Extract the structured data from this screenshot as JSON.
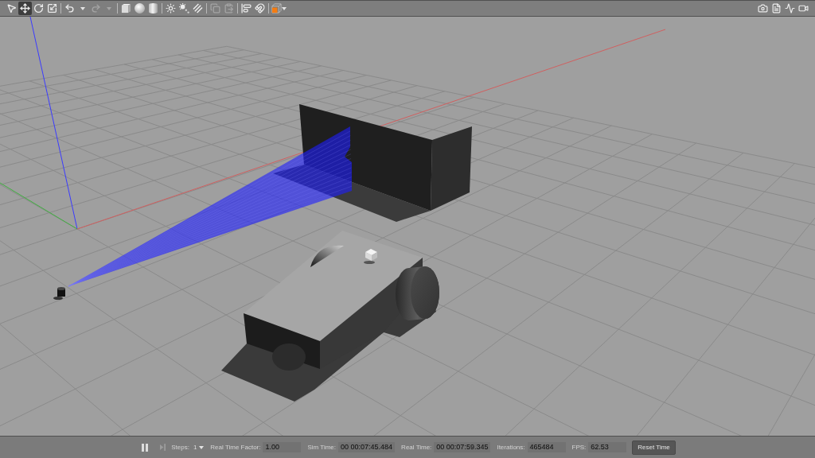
{
  "toolbar": {
    "transform_modes": [
      {
        "selected": false
      },
      {
        "selected": true
      },
      {
        "selected": false
      },
      {
        "selected": false
      }
    ],
    "history": [
      {
        "disabled": false
      },
      {
        "disabled": true
      }
    ],
    "clipboard": [
      {
        "disabled": true
      },
      {
        "disabled": true
      }
    ]
  },
  "status_bar": {
    "play_pause": {
      "running": true
    },
    "step_button": {
      "disabled": true
    },
    "steps": {
      "label": "Steps:",
      "value": "1"
    },
    "readouts": [
      {
        "label": "Real Time Factor:",
        "value": "1.00"
      },
      {
        "label": "Sim Time:",
        "value": "00 00:07:45.484"
      },
      {
        "label": "Real Time:",
        "value": "00 00:07:59.345"
      },
      {
        "label": "Iterations:",
        "value": "465484"
      },
      {
        "label": "FPS:",
        "value": "62.53"
      }
    ],
    "reset_button": "Reset Time"
  }
}
